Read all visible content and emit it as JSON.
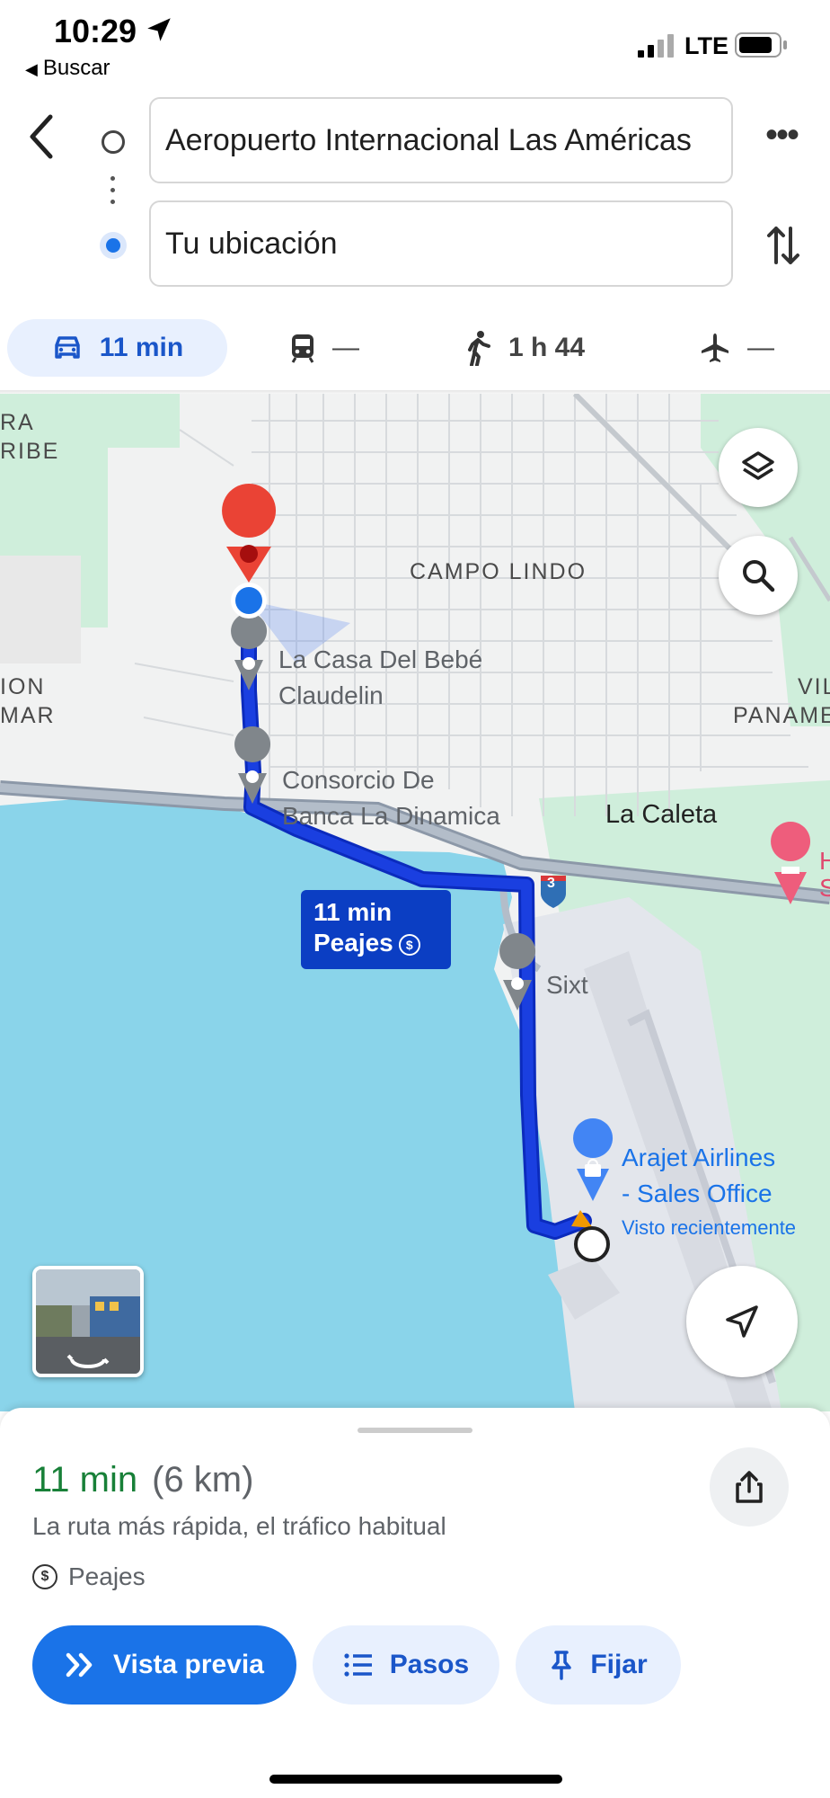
{
  "status_bar": {
    "time": "10:29",
    "back_app": "Buscar",
    "network": "LTE"
  },
  "route": {
    "origin": "Aeropuerto Internacional Las Américas",
    "destination": "Tu ubicación"
  },
  "modes": {
    "car": "11 min",
    "transit": "—",
    "walk": "1 h 44",
    "flight": "—"
  },
  "map": {
    "labels": {
      "ribe_top": "RA",
      "ribe_bottom": "RIBE",
      "campo_lindo": "CAMPO LINDO",
      "ion": "ION",
      "mar": "MAR",
      "vil": "VIL",
      "paname": "PANAME",
      "la_caleta": "La Caleta",
      "hotel_h": "H",
      "hotel_s": "S",
      "highway_shield": "3"
    },
    "pois": {
      "casa_bebe_1": "La Casa Del Bebé",
      "casa_bebe_2": "Claudelin",
      "consorcio_1": "Consorcio De",
      "consorcio_2": "Banca La Dinamica",
      "sixt": "Sixt",
      "arajet_1": "Arajet Airlines",
      "arajet_2": "- Sales Office",
      "arajet_3": "Visto recientemente"
    },
    "route_tag": {
      "duration": "11 min",
      "tolls": "Peajes"
    },
    "icons": [
      "layers-icon",
      "search-icon",
      "my-location-icon",
      "street-view-thumbnail"
    ]
  },
  "summary": {
    "duration": "11 min",
    "distance": "(6 km)",
    "description": "La ruta más rápida, el tráfico habitual",
    "tolls": "Peajes"
  },
  "actions": {
    "preview": "Vista previa",
    "steps": "Pasos",
    "pin": "Fijar"
  },
  "colors": {
    "accent": "#1a73e8",
    "route": "#1a3fe0",
    "water": "#8ad4ea",
    "park": "#c8ebd2",
    "eta_green": "#188038",
    "pin_red": "#ea4335"
  }
}
